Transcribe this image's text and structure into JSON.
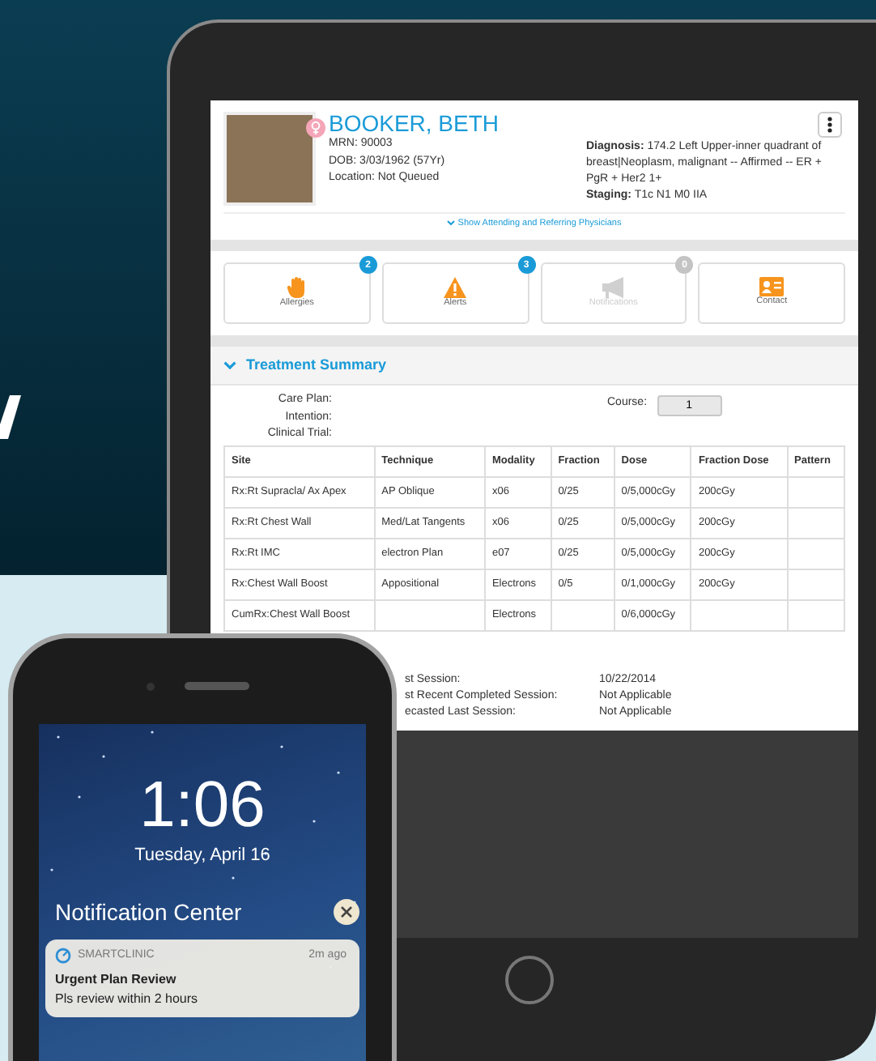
{
  "patient": {
    "name": "BOOKER, BETH",
    "mrn": "MRN: 90003",
    "dob": "DOB: 3/03/1962 (57Yr)",
    "location": "Location: Not Queued",
    "diagnosis": "**Diagnosis:** 174.2 Left Upper-inner quadrant of breast|Neoplasm, malignant -- Affirmed -- ER + PgR + Her2 1+",
    "staging": "**Staging:** T1c N1 M0 IIA",
    "physicians_link": "Show Attending and Referring Physicians"
  },
  "tiles": [
    {
      "kind": "allergies",
      "label": "Allergies",
      "count": "2",
      "disabled": false
    },
    {
      "kind": "alerts",
      "label": "Alerts",
      "count": "3",
      "disabled": false
    },
    {
      "kind": "notifications",
      "label": "Notifications",
      "count": "0",
      "disabled": true
    },
    {
      "kind": "contact",
      "label": "Contact",
      "disabled": false
    }
  ],
  "treatment_summary": {
    "title": "Treatment Summary",
    "expanded": true,
    "fields": [
      "Care Plan:",
      "Intention:",
      "Clinical Trial:"
    ],
    "course_label": "Course:",
    "course_value": "1",
    "table": {
      "columns": [
        "Site",
        "Technique",
        "Modality",
        "Fraction",
        "Dose",
        "Fraction Dose",
        "Pattern"
      ],
      "rows": [
        [
          "Rx:Rt Supracla/ Ax Apex",
          "AP Oblique",
          "x06",
          "0/25",
          "0/5,000cGy",
          "200cGy",
          ""
        ],
        [
          "Rx:Rt Chest Wall",
          "Med/Lat Tangents",
          "x06",
          "0/25",
          "0/5,000cGy",
          "200cGy",
          ""
        ],
        [
          "Rx:Rt IMC",
          "electron Plan",
          "e07",
          "0/25",
          "0/5,000cGy",
          "200cGy",
          ""
        ],
        [
          "Rx:Chest Wall Boost",
          "Appositional",
          "Electrons",
          "0/5",
          "0/1,000cGy",
          "200cGy",
          ""
        ],
        [
          "CumRx:Chest Wall Boost",
          "",
          "Electrons",
          "",
          "0/6,000cGy",
          "",
          ""
        ]
      ]
    },
    "sessions": [
      {
        "label": "st Session:",
        "value": "10/22/2014"
      },
      {
        "label": "st Recent Completed Session:",
        "value": "Not Applicable"
      },
      {
        "label": "ecasted Last Session:",
        "value": "Not Applicable"
      }
    ]
  },
  "phone": {
    "time": "1:06",
    "date": "Tuesday, April 16",
    "notification_center": "Notification Center",
    "notification": {
      "app": "SMARTCLINIC",
      "time": "2m ago",
      "title": "Urgent Plan Review",
      "body": "Pls review within 2 hours"
    }
  }
}
